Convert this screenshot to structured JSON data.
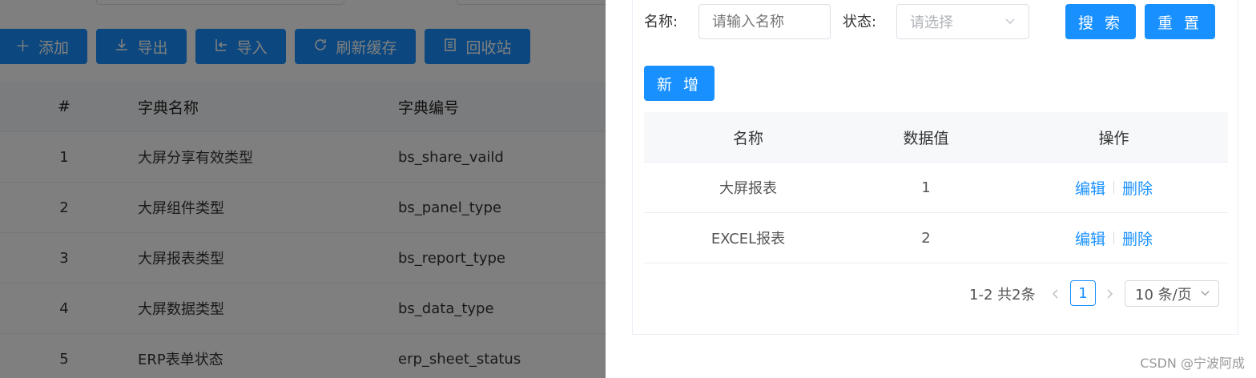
{
  "background": {
    "toolbar": {
      "add_label": "添加",
      "export_label": "导出",
      "import_label": "导入",
      "refresh_label": "刷新缓存",
      "recycle_label": "回收站"
    },
    "table": {
      "headers": [
        "#",
        "字典名称",
        "字典编号"
      ],
      "rows": [
        {
          "idx": "1",
          "name": "大屏分享有效类型",
          "code": "bs_share_vaild"
        },
        {
          "idx": "2",
          "name": "大屏组件类型",
          "code": "bs_panel_type"
        },
        {
          "idx": "3",
          "name": "大屏报表类型",
          "code": "bs_report_type"
        },
        {
          "idx": "4",
          "name": "大屏数据类型",
          "code": "bs_data_type"
        },
        {
          "idx": "5",
          "name": "ERP表单状态",
          "code": "erp_sheet_status"
        }
      ]
    }
  },
  "drawer": {
    "search": {
      "name_label": "名称:",
      "name_placeholder": "请输入名称",
      "status_label": "状态:",
      "status_placeholder": "请选择",
      "search_label": "搜 索",
      "reset_label": "重 置"
    },
    "add_label": "新 增",
    "table": {
      "headers": [
        "名称",
        "数据值",
        "操作"
      ],
      "rows": [
        {
          "name": "大屏报表",
          "value": "1",
          "edit": "编辑",
          "delete": "删除"
        },
        {
          "name": "EXCEL报表",
          "value": "2",
          "edit": "编辑",
          "delete": "删除"
        }
      ]
    },
    "pagination": {
      "total": "1-2 共2条",
      "current_page": "1",
      "page_size": "10 条/页"
    }
  },
  "watermark": "CSDN @宁波阿成",
  "colors": {
    "primary": "#1890ff",
    "mask": "rgba(0,0,0,0.5)"
  }
}
